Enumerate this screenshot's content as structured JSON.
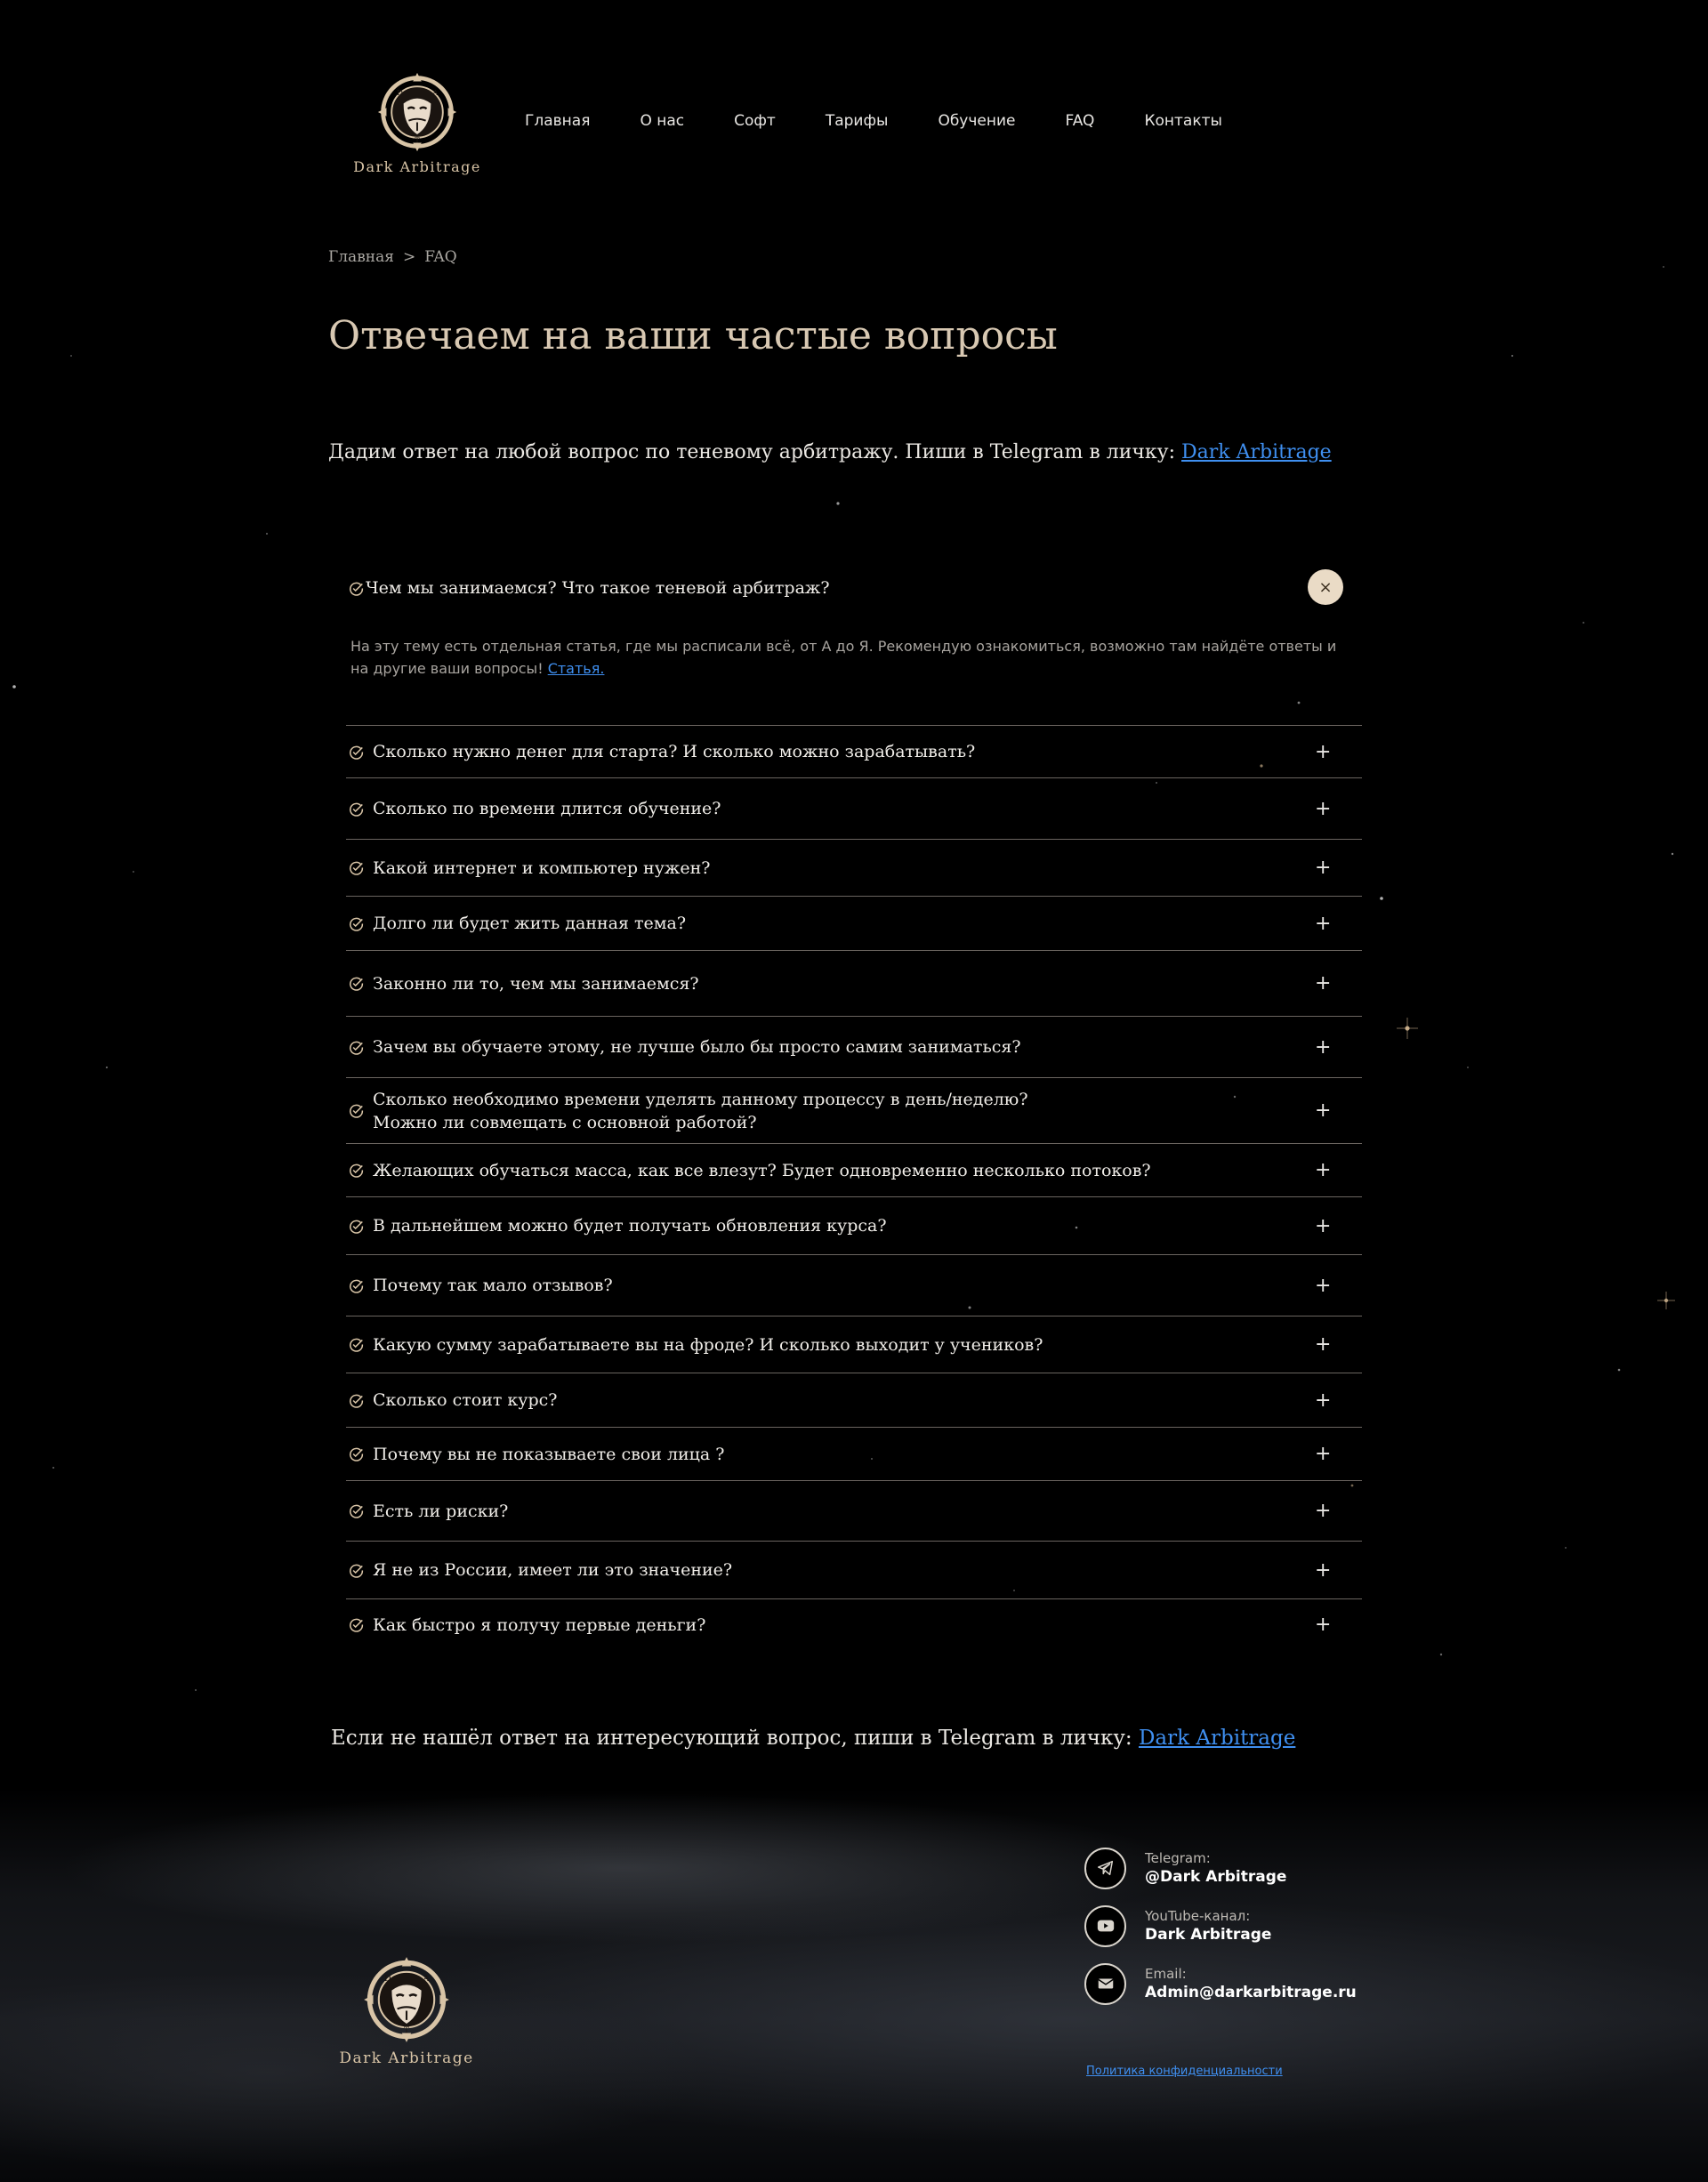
{
  "logo": {
    "text": "Dark Arbitrage",
    "letters": [
      "D",
      "A",
      "T"
    ]
  },
  "nav": {
    "items": [
      {
        "label": "Главная"
      },
      {
        "label": "О нас"
      },
      {
        "label": "Софт"
      },
      {
        "label": "Тарифы"
      },
      {
        "label": "Обучение"
      },
      {
        "label": "FAQ"
      },
      {
        "label": "Контакты"
      }
    ]
  },
  "breadcrumb": {
    "home": "Главная",
    "separator": ">",
    "current": "FAQ"
  },
  "page": {
    "title": "Отвечаем на ваши частые вопросы",
    "intro_text": "Дадим ответ на любой вопрос по теневому арбитражу. Пиши в Telegram в личку: ",
    "intro_link": "Dark Arbitrage",
    "outro_text": "Если не нашёл ответ на интересующий вопрос, пиши в Telegram в личку: ",
    "outro_link": "Dark Arbitrage"
  },
  "faq": {
    "open": {
      "question": "Чем мы занимаемся? Что такое теневой арбитраж?",
      "answer": "На эту тему есть отдельная статья, где мы расписали всё, от А до Я. Рекомендую ознакомиться, возможно там найдёте ответы и на другие ваши вопросы! ",
      "answer_link": "Статья.",
      "close_icon": "×"
    },
    "items": [
      {
        "q1": "Сколько нужно денег для старта? И сколько можно зарабатывать?"
      },
      {
        "q1": "Сколько по времени длится обучение?"
      },
      {
        "q1": "Какой интернет и компьютер нужен?"
      },
      {
        "q1": "Долго ли будет жить данная тема?"
      },
      {
        "q1": "Законно ли то, чем мы занимаемся?"
      },
      {
        "q1": "Зачем вы обучаете этому, не лучше было бы просто самим заниматься?"
      },
      {
        "q1": "Сколько необходимо времени уделять данному процессу в день/неделю?",
        "q2": "Можно ли совмещать с основной работой?"
      },
      {
        "q1": "Желающих обучаться масса, как все влезут? Будет одновременно несколько потоков?"
      },
      {
        "q1": "В дальнейшем можно будет получать обновления курса?"
      },
      {
        "q1": "Почему так мало отзывов?"
      },
      {
        "q1": "Какую сумму зарабатываете вы на фроде? И сколько выходит у учеников?"
      },
      {
        "q1": "Сколько стоит курс?"
      },
      {
        "q1": "Почему вы не показываете свои лица ?"
      },
      {
        "q1": "Есть ли риски?"
      },
      {
        "q1": "Я не из России, имеет ли это значение?"
      },
      {
        "q1": "Как быстро я получу первые деньги?"
      }
    ],
    "plus_icon": "+"
  },
  "footer": {
    "contacts": [
      {
        "icon": "telegram-icon",
        "label": "Telegram:",
        "value": "@Dark Arbitrage"
      },
      {
        "icon": "youtube-icon",
        "label": "YouTube-канал:",
        "value": "Dark Arbitrage"
      },
      {
        "icon": "email-icon",
        "label": "Email:",
        "value": "Admin@darkarbitrage.ru"
      }
    ],
    "privacy": "Политика конфиденциальности"
  },
  "colors": {
    "accent_gold": "#d8c4a6",
    "link_blue": "#3f8ff0",
    "close_button_bg": "#eadbc6",
    "divider": "#6b6560"
  }
}
